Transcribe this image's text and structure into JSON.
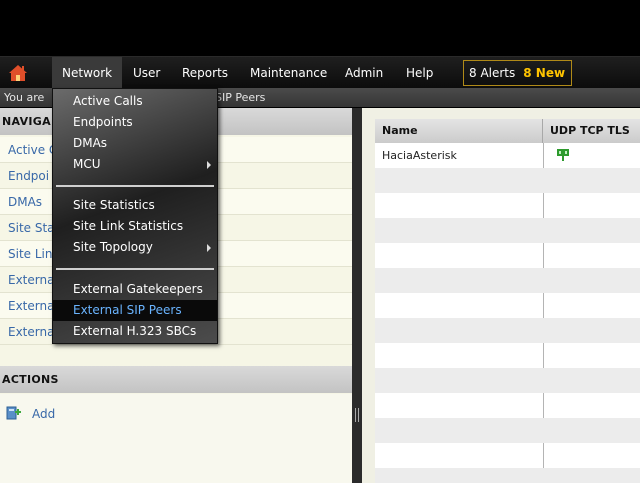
{
  "nav": {
    "items": [
      "Network",
      "User",
      "Reports",
      "Maintenance",
      "Admin",
      "Help"
    ],
    "alerts_count": "8 Alerts",
    "alerts_new": "8 New"
  },
  "breadcrumb": {
    "prefix": "You are",
    "tail": "SIP Peers"
  },
  "left": {
    "navigation_header": "NAVIGA",
    "nav_items": [
      "Active C",
      "Endpoi",
      "DMAs",
      "Site Sta",
      "Site Lin",
      "Externa",
      "Externa",
      "Externa"
    ],
    "actions_header": "ACTIONS",
    "add_label": "Add"
  },
  "grid": {
    "col_name": "Name",
    "col_transport": "UDP TCP TLS",
    "rows": [
      {
        "name": "HaciaAsterisk"
      }
    ]
  },
  "menu": {
    "items": [
      "Active Calls",
      "Endpoints",
      "DMAs",
      "MCU",
      "Site Statistics",
      "Site Link Statistics",
      "Site Topology",
      "External Gatekeepers",
      "External SIP Peers",
      "External H.323 SBCs"
    ],
    "selected": "External SIP Peers"
  },
  "colors": {
    "link": "#3868a8",
    "alert_border": "#b08a18",
    "new_badge": "#ffc400",
    "menu_selected": "#6ab4ff"
  },
  "icons": {
    "home": "home-icon",
    "add": "add-icon",
    "transport": "network-plug-icon",
    "submenu": "chevron-right-icon"
  }
}
